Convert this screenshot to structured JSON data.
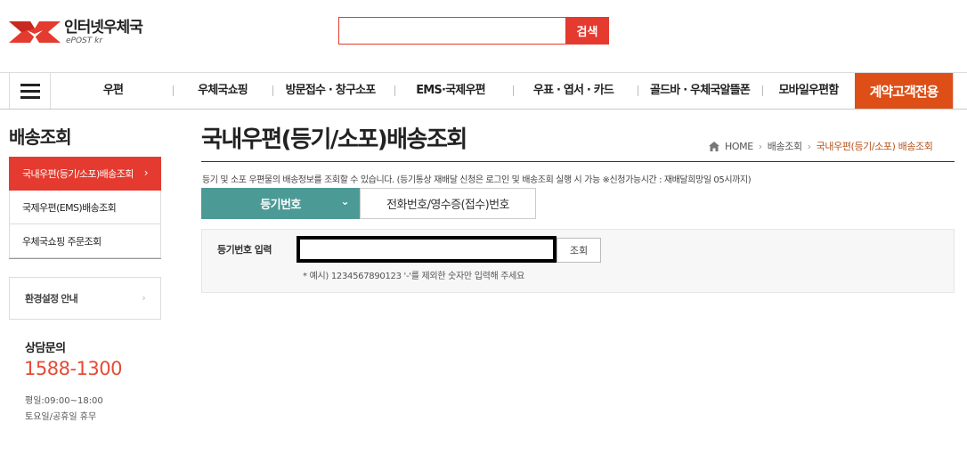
{
  "header": {
    "logo_title": "인터넷우체국",
    "logo_sub": "ePOST kr",
    "search_placeholder": "",
    "search_button": "검색"
  },
  "gnb": {
    "items": [
      {
        "label": "우편"
      },
      {
        "label": "우체국쇼핑"
      },
      {
        "label": "방문접수 · 창구소포"
      },
      {
        "label": "EMS·국제우편"
      },
      {
        "label": "우표 · 엽서 · 카드"
      },
      {
        "label": "골드바 · 우체국알뜰폰"
      },
      {
        "label": "모바일우편함"
      }
    ],
    "contract": "계약고객전용"
  },
  "sidebar": {
    "title": "배송조회",
    "items": [
      {
        "label": "국내우편(등기/소포)배송조회",
        "active": true
      },
      {
        "label": "국제우편(EMS)배송조회",
        "active": false
      },
      {
        "label": "우체국쇼핑 주문조회",
        "active": false
      }
    ],
    "env_label": "환경설정 안내",
    "contact_title": "상담문의",
    "contact_phone": "1588-1300",
    "hours_weekday": "평일:09:00~18:00",
    "hours_weekend": "토요일/공휴일 휴무"
  },
  "main": {
    "title": "국내우편(등기/소포)배송조회",
    "breadcrumb": [
      "HOME",
      "배송조회",
      "국내우편(등기/소포) 배송조회"
    ],
    "description": "등기 및 소포 우편물의 배송정보를 조회할 수 있습니다. (등기통상 재배달 신청은 로그인 및 배송조회 실행 시 가능 ※신청가능시간 : 재배달희망일 05시까지)",
    "tab_active": "등기번호",
    "tab_inactive": "전화번호/영수증(접수)번호",
    "input_label": "등기번호 입력",
    "input_value": "",
    "query_button": "조회",
    "hint": "* 예시) 1234567890123 '-'를 제외한 숫자만 입력해 주세요"
  },
  "colors": {
    "brand_red": "#e43a2f",
    "contract_orange": "#dd4f17",
    "tab_teal": "#4c9a96",
    "phone_red": "#e44b35"
  }
}
